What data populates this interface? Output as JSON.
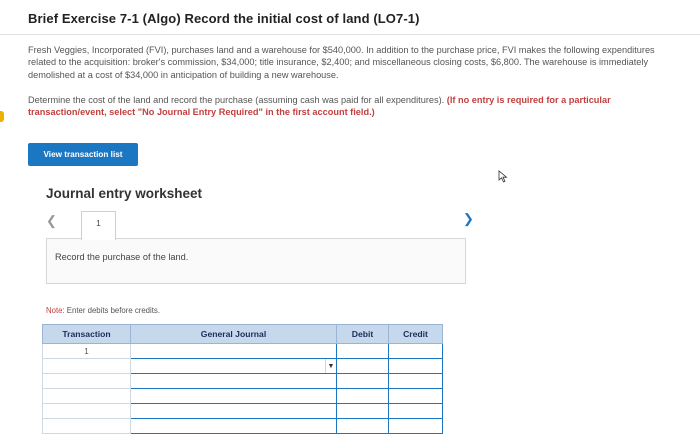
{
  "header": {
    "title": "Brief Exercise 7-1 (Algo) Record the initial cost of land (LO7-1)"
  },
  "problem": {
    "paragraph1": "Fresh Veggies, Incorporated (FVI), purchases land and a warehouse for $540,000. In addition to the purchase price, FVI makes the following expenditures related to the acquisition: broker's commission, $34,000; title insurance, $2,400; and miscellaneous closing costs, $6,800. The warehouse is immediately demolished at a cost of $34,000 in anticipation of building a new warehouse.",
    "paragraph2_normal": "Determine the cost of the land and record the purchase (assuming cash was paid for all expenditures).",
    "paragraph2_emphasis": "(If no entry is required for a particular transaction/event, select \"No Journal Entry Required\" in the first account field.)"
  },
  "buttons": {
    "view_transaction_list": "View transaction list"
  },
  "worksheet": {
    "title": "Journal entry worksheet",
    "current_page": "1",
    "instruction": "Record the purchase of the land.",
    "note_label": "Note:",
    "note_text": " Enter debits before credits."
  },
  "journal_table": {
    "headers": {
      "transaction": "Transaction",
      "general_journal": "General Journal",
      "debit": "Debit",
      "credit": "Credit"
    },
    "rows": [
      {
        "transaction": "1"
      },
      {
        "transaction": ""
      },
      {
        "transaction": ""
      },
      {
        "transaction": ""
      },
      {
        "transaction": ""
      },
      {
        "transaction": ""
      }
    ]
  },
  "colors": {
    "primary_blue": "#1c77c3",
    "emphasis_red": "#c23f3f",
    "header_fill": "#c6d8ec"
  },
  "icons": {
    "prev": "chevron-left-icon",
    "next": "chevron-right-icon",
    "dropdown": "dropdown-arrow-icon",
    "cursor": "mouse-pointer-icon"
  }
}
